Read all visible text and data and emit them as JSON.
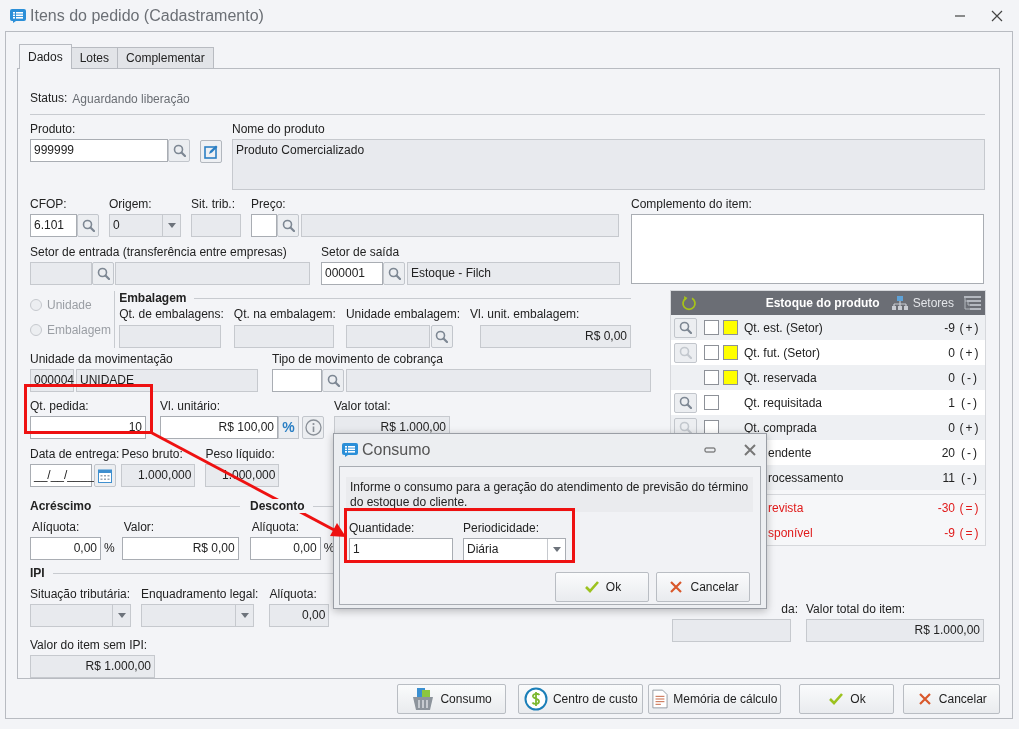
{
  "window": {
    "title": "Itens do pedido (Cadastramento)"
  },
  "tabs": [
    {
      "label": "Dados",
      "selected": true
    },
    {
      "label": "Lotes",
      "selected": false
    },
    {
      "label": "Complementar",
      "selected": false
    }
  ],
  "status": {
    "label": "Status:",
    "value": "Aguardando liberação"
  },
  "produto": {
    "label": "Produto:",
    "value": "999999",
    "editable": true
  },
  "nome_produto": {
    "label": "Nome do produto",
    "value": "Produto Comercializado",
    "editable": false
  },
  "cfop": {
    "label": "CFOP:",
    "value": "6.101",
    "editable": true
  },
  "origem": {
    "label": "Origem:",
    "value": "0",
    "editable": false
  },
  "sit_trib": {
    "label": "Sit. trib.:",
    "editable": false
  },
  "preco": {
    "label": "Preço:",
    "editable": true
  },
  "setor_entrada": {
    "label": "Setor de entrada (transferência entre empresas)",
    "editable": false
  },
  "setor_saida": {
    "label": "Setor de saída",
    "code": "000001",
    "name": "Estoque - Filch",
    "editable": true
  },
  "quantity_mode": [
    {
      "label": "Unidade",
      "selected": false,
      "disabled": true
    },
    {
      "label": "Embalagem",
      "selected": false,
      "disabled": true
    }
  ],
  "embalagem": {
    "title": "Embalagem",
    "fields": [
      {
        "label": "Qt. de embalagens:",
        "editable": false
      },
      {
        "label": "Qt. na embalagem:",
        "editable": false
      },
      {
        "label": "Unidade embalagem:",
        "editable": false
      },
      {
        "label": "Vl. unit. embalagem:",
        "value": "R$ 0,00",
        "editable": false
      }
    ]
  },
  "unidade_mov": {
    "label": "Unidade da movimentação",
    "code": "000004",
    "name": "UNIDADE",
    "editable": false
  },
  "tipo_mov": {
    "label": "Tipo de movimento de cobrança",
    "editable": true
  },
  "qt_pedida": {
    "label": "Qt. pedida:",
    "value": "10",
    "editable": true
  },
  "vl_unitario": {
    "label": "Vl. unitário:",
    "value": "R$ 100,00",
    "editable": true,
    "percent": "%"
  },
  "valor_total": {
    "label": "Valor total:",
    "value": "R$ 1.000,00",
    "editable": false
  },
  "data_entrega": {
    "label": "Data de entrega:",
    "value": "__/__/____",
    "editable": true
  },
  "peso_bruto": {
    "label": "Peso bruto:",
    "value": "1.000,000",
    "editable": false
  },
  "peso_liquido": {
    "label": "Peso líquido:",
    "value": "1.000,000",
    "editable": false
  },
  "acrescimo": {
    "title": "Acréscimo",
    "aliquota": {
      "label": "Alíquota:",
      "value": "0,00",
      "unit": "%",
      "editable": true
    },
    "valor": {
      "label": "Valor:",
      "value": "R$ 0,00",
      "editable": true
    }
  },
  "desconto": {
    "title": "Desconto",
    "aliquota": {
      "label": "Alíquota:",
      "value": "0,00",
      "unit": "%",
      "editable": true
    }
  },
  "ipi": {
    "title": "IPI",
    "situacao": {
      "label": "Situação tributária:"
    },
    "enquadramento": {
      "label": "Enquadramento legal:"
    },
    "aliquota": {
      "label": "Alíquota:",
      "value": "0,00",
      "editable": false
    }
  },
  "valor_sem_ipi": {
    "label": "Valor do item sem IPI:",
    "value": "R$ 1.000,00",
    "editable": false
  },
  "complemento": {
    "label": "Complemento do item:",
    "editable": true
  },
  "estoque": {
    "title": "Estoque do produto",
    "setores": "Setores",
    "rows": [
      {
        "label": "Qt. est. (Setor)",
        "value": "-9",
        "sign": "(+)",
        "search_button": {
          "disabled": false
        },
        "checked": false,
        "flag": true
      },
      {
        "label": "Qt. fut. (Setor)",
        "value": "0",
        "sign": "(+)",
        "search_button": {
          "disabled": true
        },
        "checked": false,
        "flag": true
      },
      {
        "label": "Qt. reservada",
        "value": "0",
        "sign": "(-)",
        "checked": false,
        "flag": true
      },
      {
        "label": "Qt. requisitada",
        "value": "1",
        "sign": "(-)",
        "search_button": {
          "disabled": false
        },
        "checked": false,
        "flag": false
      },
      {
        "label": "Qt. comprada",
        "value": "0",
        "sign": "(+)",
        "search_button": {
          "disabled": true
        },
        "checked": false,
        "flag": false
      },
      {
        "label": "endente",
        "value": "20",
        "sign": "(-)"
      },
      {
        "label": "rocessamento",
        "value": "11",
        "sign": "(-)"
      }
    ],
    "balances": [
      {
        "label": "revista",
        "value": "-30",
        "sign": "(=)"
      },
      {
        "label": "sponível",
        "value": "-9",
        "sign": "(=)"
      }
    ]
  },
  "totals": [
    {
      "label": "da:",
      "editable": false
    },
    {
      "label": "Valor total do item:",
      "value": "R$ 1.000,00",
      "editable": false
    }
  ],
  "footer_buttons": [
    {
      "label": "Consumo",
      "kind": "basket"
    },
    {
      "label": "Centro de custo",
      "kind": "coin"
    },
    {
      "label": "Memória de cálculo",
      "kind": "document"
    },
    {
      "label": "Ok",
      "kind": "ok"
    },
    {
      "label": "Cancelar",
      "kind": "cancel"
    }
  ],
  "dialog": {
    "title": "Consumo",
    "message": "Informe o consumo para a geração do atendimento de previsão do término do estoque do cliente.",
    "quantidade": {
      "label": "Quantidade:",
      "value": "1",
      "editable": true
    },
    "periodicidade": {
      "label": "Periodicidade:",
      "value": "Diária"
    },
    "buttons": [
      {
        "label": "Ok",
        "kind": "ok"
      },
      {
        "label": "Cancelar",
        "kind": "cancel"
      }
    ]
  }
}
